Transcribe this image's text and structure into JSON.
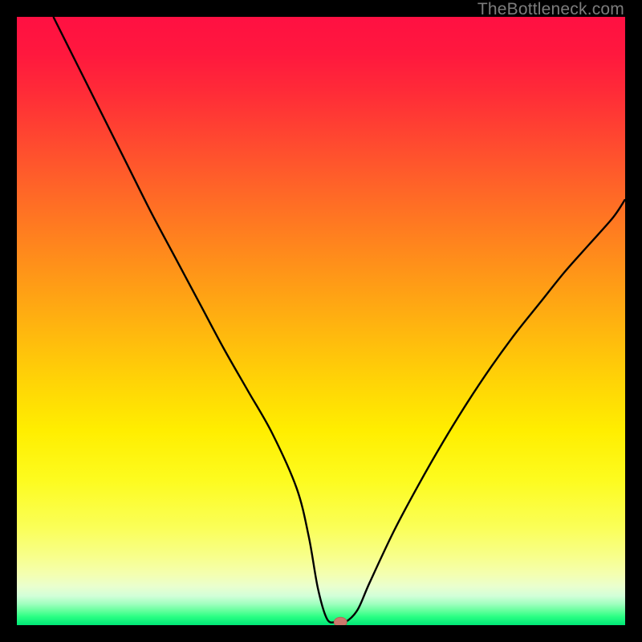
{
  "watermark": "TheBottleneck.com",
  "colors": {
    "black": "#000000",
    "watermark": "#7c7c7c",
    "curve": "#000000",
    "marker_fill": "#cd786c",
    "marker_stroke": "#b46458"
  },
  "gradient_stops": [
    {
      "offset": 0.0,
      "color": "#ff1042"
    },
    {
      "offset": 0.06,
      "color": "#ff183e"
    },
    {
      "offset": 0.12,
      "color": "#ff2a38"
    },
    {
      "offset": 0.2,
      "color": "#ff4730"
    },
    {
      "offset": 0.28,
      "color": "#ff6428"
    },
    {
      "offset": 0.36,
      "color": "#ff801f"
    },
    {
      "offset": 0.44,
      "color": "#ff9c16"
    },
    {
      "offset": 0.52,
      "color": "#ffb80e"
    },
    {
      "offset": 0.6,
      "color": "#ffd406"
    },
    {
      "offset": 0.68,
      "color": "#ffee00"
    },
    {
      "offset": 0.76,
      "color": "#fdfb1e"
    },
    {
      "offset": 0.84,
      "color": "#faff58"
    },
    {
      "offset": 0.886,
      "color": "#f8ff8a"
    },
    {
      "offset": 0.916,
      "color": "#f4ffb0"
    },
    {
      "offset": 0.936,
      "color": "#eaffce"
    },
    {
      "offset": 0.952,
      "color": "#d2ffd8"
    },
    {
      "offset": 0.965,
      "color": "#a0ffbf"
    },
    {
      "offset": 0.976,
      "color": "#66ff9e"
    },
    {
      "offset": 0.986,
      "color": "#2bff84"
    },
    {
      "offset": 1.0,
      "color": "#00e676"
    }
  ],
  "chart_data": {
    "type": "line",
    "title": "",
    "xlabel": "",
    "ylabel": "",
    "xlim": [
      0,
      100
    ],
    "ylim": [
      0,
      100
    ],
    "series": [
      {
        "name": "bottleneck-curve",
        "x": [
          6.0,
          10.0,
          14.0,
          18.0,
          22.0,
          26.0,
          30.0,
          34.0,
          38.0,
          42.0,
          46.0,
          48.0,
          49.5,
          51.0,
          52.5,
          54.0,
          56.0,
          58.0,
          62.0,
          66.0,
          70.0,
          74.0,
          78.0,
          82.0,
          86.0,
          90.0,
          94.0,
          98.0,
          100.0
        ],
        "y": [
          100.0,
          92.0,
          84.0,
          76.0,
          68.0,
          60.5,
          53.0,
          45.5,
          38.5,
          31.5,
          22.5,
          14.5,
          6.0,
          1.0,
          0.5,
          0.5,
          2.5,
          7.0,
          15.5,
          23.0,
          30.0,
          36.5,
          42.5,
          48.0,
          53.0,
          58.0,
          62.5,
          67.0,
          70.0
        ]
      }
    ],
    "marker": {
      "x": 53.2,
      "y": 0.5,
      "rx": 8,
      "ry": 6
    }
  }
}
